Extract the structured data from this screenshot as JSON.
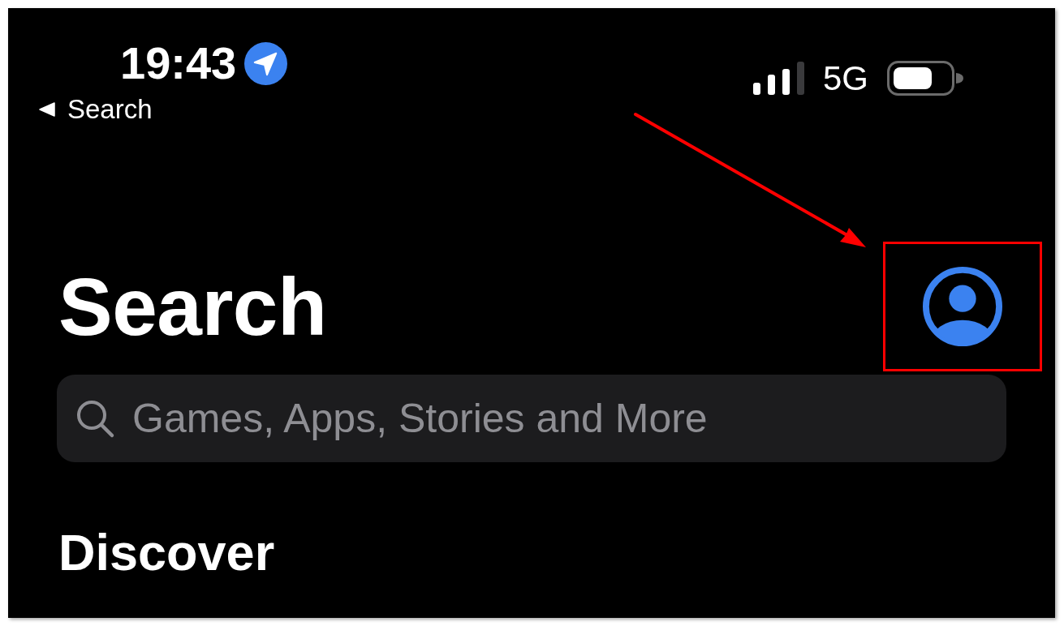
{
  "status_bar": {
    "time": "19:43",
    "location_active": true,
    "back_label": "Search",
    "network": "5G"
  },
  "header": {
    "title": "Search",
    "account_button": {
      "highlighted": true
    }
  },
  "search": {
    "placeholder": "Games, Apps, Stories and More"
  },
  "sections": [
    {
      "title": "Discover"
    }
  ]
}
